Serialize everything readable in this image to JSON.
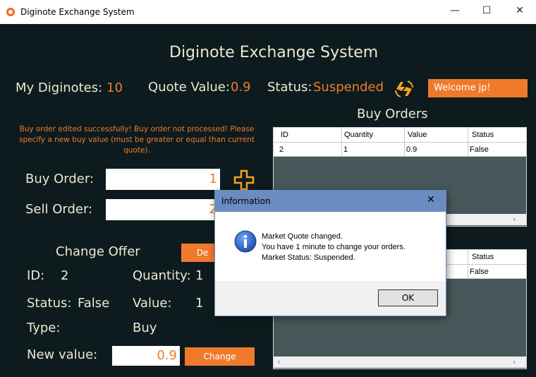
{
  "window": {
    "title": "Diginote Exchange System",
    "minimize_glyph": "—",
    "maximize_glyph": "☐",
    "close_glyph": "✕"
  },
  "header": {
    "app_title": "Diginote Exchange System",
    "my_diginotes_label": "My Diginotes:",
    "my_diginotes_value": "10",
    "quote_label": "Quote Value:",
    "quote_value": "0.9",
    "status_label": "Status:",
    "status_value": "Suspended",
    "refresh_icon": "lightning-refresh-icon",
    "welcome_button": "Welcome jp!"
  },
  "message": "Buy order edited successfully! Buy order not processed! Please specify a new buy value (must be greater or equal than current quote).",
  "orders_form": {
    "buy_label": "Buy Order:",
    "buy_value": "1",
    "sell_label": "Sell Order:",
    "sell_value": "2",
    "add_icon": "plus-icon"
  },
  "change_offer": {
    "title": "Change Offer",
    "delete_button": "De",
    "id_label": "ID:",
    "id_value": "2",
    "quantity_label": "Quantity:",
    "quantity_value": "1",
    "status_label": "Status:",
    "status_value": "False",
    "value_label": "Value:",
    "value_value": "1",
    "type_label": "Type:",
    "type_value": "Buy",
    "new_value_label": "New value:",
    "new_value": "0.9",
    "change_button": "Change"
  },
  "buy_orders": {
    "title": "Buy Orders",
    "columns": [
      "ID",
      "Quantity",
      "Value",
      "Status"
    ],
    "rows": [
      [
        "2",
        "1",
        "0.9",
        "False"
      ]
    ]
  },
  "sell_orders": {
    "columns_visible": [
      "Status"
    ],
    "rows_visible": [
      [
        "False"
      ]
    ]
  },
  "dialog": {
    "title": "Information",
    "icon": "info-icon",
    "lines": [
      "Market Quote changed.",
      "You have 1 minute to change your orders.",
      "Market Status: Suspended."
    ],
    "ok_button": "OK",
    "close_glyph": "✕"
  },
  "colors": {
    "background": "#0d1b1e",
    "accent": "#f07a2c",
    "label": "#ece8d2",
    "grid": "#48585a",
    "dialog_title": "#6a8cc0"
  }
}
